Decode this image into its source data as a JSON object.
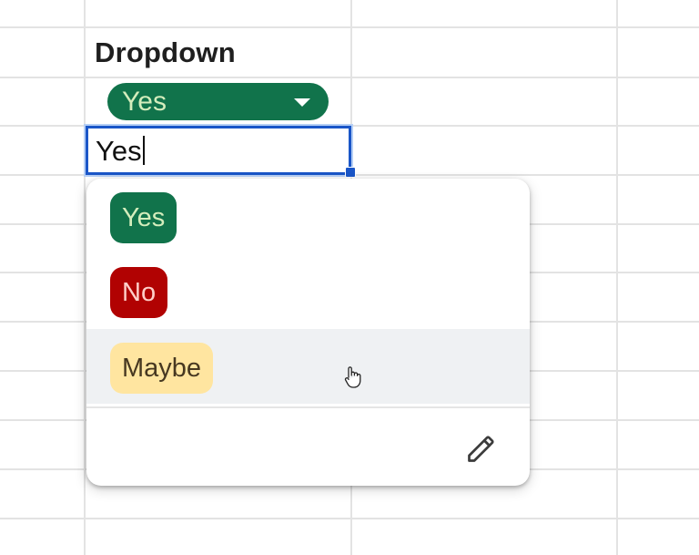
{
  "sheet": {
    "header": "Dropdown",
    "dropdown_cell": {
      "value": "Yes",
      "chip_bg": "#11734b",
      "chip_fg": "#d4edbc",
      "caret_icon": "caret-down-icon"
    },
    "edit_cell": {
      "value": "Yes",
      "border_color": "#1a56c8"
    }
  },
  "dropdown": {
    "options": [
      {
        "label": "Yes",
        "bg": "#11734b",
        "fg": "#d4edbc",
        "hovered": false
      },
      {
        "label": "No",
        "bg": "#b10202",
        "fg": "#ffcfc9",
        "hovered": false
      },
      {
        "label": "Maybe",
        "bg": "#ffe5a0",
        "fg": "#473821",
        "hovered": true
      }
    ],
    "edit_icon": "pencil-icon",
    "hover_bg": "#eff1f3"
  }
}
